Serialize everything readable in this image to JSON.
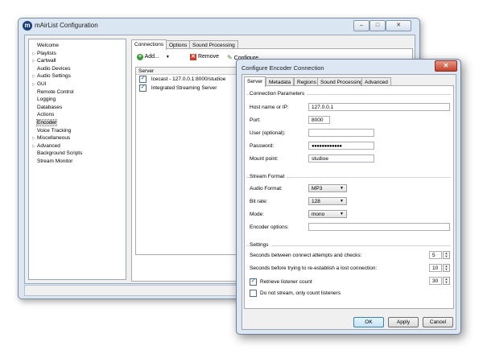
{
  "main_window": {
    "title": "mAirList Configuration",
    "caption_minimize": "–",
    "caption_maximize": "□",
    "caption_close": "✕",
    "tree": [
      {
        "label": "Welcome",
        "twisty": ""
      },
      {
        "label": "Playlists",
        "twisty": "▷"
      },
      {
        "label": "Cartwall",
        "twisty": "▷"
      },
      {
        "label": "Audio Devices",
        "twisty": ""
      },
      {
        "label": "Audio Settings",
        "twisty": "▷"
      },
      {
        "label": "GUI",
        "twisty": "▷"
      },
      {
        "label": "Remote Control",
        "twisty": ""
      },
      {
        "label": "Logging",
        "twisty": ""
      },
      {
        "label": "Databases",
        "twisty": ""
      },
      {
        "label": "Actions",
        "twisty": ""
      },
      {
        "label": "Encoder",
        "twisty": ""
      },
      {
        "label": "Voice Tracking",
        "twisty": ""
      },
      {
        "label": "Miscellaneous",
        "twisty": "▷"
      },
      {
        "label": "Advanced",
        "twisty": "▷"
      },
      {
        "label": "Background Scripts",
        "twisty": ""
      },
      {
        "label": "Stream Monitor",
        "twisty": ""
      }
    ],
    "selected_tree_item": "Encoder",
    "tabs": [
      "Connections",
      "Options",
      "Sound Processing"
    ],
    "toolbar": {
      "add": "Add...",
      "remove": "Remove",
      "configure": "Configure"
    },
    "list_header": "Server",
    "servers": [
      {
        "label": "Icecast - 127.0.0.1:8000/studioe",
        "checked": true
      },
      {
        "label": "Integrated Streaming Server",
        "checked": true
      }
    ]
  },
  "dialog": {
    "title": "Configure Encoder Connection",
    "close": "✕",
    "tabs": [
      "Server",
      "Metadata",
      "Regions",
      "Sound Processing",
      "Advanced"
    ],
    "connection": {
      "group_title": "Connection Parameters",
      "host_label": "Host name or IP:",
      "host_value": "127.0.0.1",
      "port_label": "Port:",
      "port_value": "8000",
      "user_label": "User (optional):",
      "user_value": "",
      "password_label": "Password:",
      "password_value": "●●●●●●●●●●●●",
      "mount_label": "Mount point:",
      "mount_value": "studioe"
    },
    "stream_format": {
      "group_title": "Stream Format",
      "audio_format_label": "Audio Format:",
      "audio_format_value": "MP3",
      "bitrate_label": "Bit rate:",
      "bitrate_value": "128",
      "mode_label": "Mode:",
      "mode_value": "mono",
      "encoder_options_label": "Encoder options:",
      "encoder_options_value": ""
    },
    "settings": {
      "group_title": "Settings",
      "retry_label": "Seconds between connect attempts and checks:",
      "retry_value": "5",
      "reestablish_label": "Seconds before trying to re-establish a lost connection:",
      "reestablish_value": "10",
      "listener_label": "Retrieve listener count",
      "listener_checked": true,
      "listener_value": "30",
      "no_stream_label": "Do not stream, only count listeners",
      "no_stream_checked": false
    },
    "buttons": {
      "ok": "OK",
      "apply": "Apply",
      "cancel": "Cancel"
    }
  },
  "colors": {
    "accent": "#3c7fb1",
    "window_frame": "#dbe6f3",
    "close_red": "#c4412a"
  }
}
